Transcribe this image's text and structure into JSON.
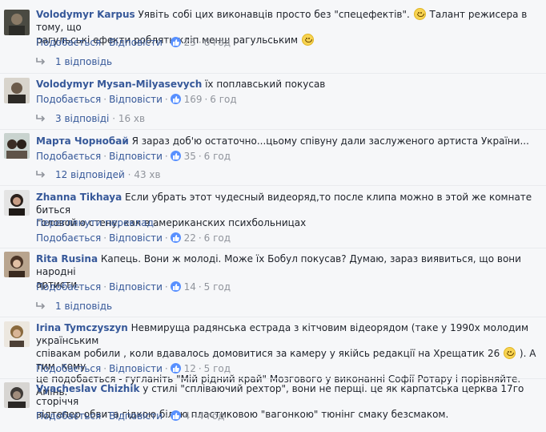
{
  "actions": {
    "like": "Подобається",
    "reply": "Відповісти",
    "dot": "·"
  },
  "comments": [
    {
      "author": "Volodymyr Karpus",
      "text_a": "Уявіть собі цих виконавців просто без \"спецефектів\".",
      "text_b": "Талант режисера в тому, що",
      "text_c": "рагульські ефекти роблять кліп менш рагульським",
      "likes": "25",
      "time": "6 год",
      "replies": "1 відповідь",
      "replies_time": ""
    },
    {
      "author": "Volodymyr Mysan-Milyasevych",
      "text_a": "їх поплавський покусав",
      "likes": "169",
      "time": "6 год",
      "replies": "3 відповіді",
      "replies_time": "16 хв"
    },
    {
      "author": "Марта Чорнобай",
      "text_a": "Я зараз доб'ю остаточно...цьому співуну дали заслуженого артиста України...",
      "likes": "35",
      "time": "6 год",
      "replies": "12 відповідей",
      "replies_time": "43 хв"
    },
    {
      "author": "Zhanna Tikhaya",
      "text_a": "Если убрать этот чудесный видеоряд,то после клипа можно в этой же комнате биться",
      "text_b": "головой о стену, как в американских психбольницах",
      "translate": "Переглянути переклад",
      "likes": "22",
      "time": "6 год"
    },
    {
      "author": "Rita Rusina",
      "text_a": "Капець. Вони ж молоді. Може їх Бобул покусав? Думаю, зараз виявиться, що вони народні",
      "text_b": "артисти.",
      "likes": "14",
      "time": "5 год",
      "replies": "1 відповідь",
      "replies_time": ""
    },
    {
      "author": "Irina Tymczyszyn",
      "text_a": "Невмируща радянська естрада з кітчовим відеорядом (таке у 1990х молодим українським",
      "text_b": "співакам робили , коли вдавалось домовитися за камеру у якійсь редакції на Хрещатик 26",
      "text_c": "). А тим, кому",
      "text_d": "це подобається - гугланіть \"Мій рідний край\" Мозгового у виконанні Софії Ротару і порівняйте. Амінь.",
      "likes": "12",
      "time": "5 год"
    },
    {
      "author": "Vyacheslav Chizhik",
      "text_a": "у стилі \"спліваючий рехтор\", вони не перщі. це як карпатська церква 17го сторіччя",
      "text_b": "відтепер обвита гідкою білою пластиковою \"вагонкою\" тюнінг смаку безсмаком.",
      "likes": "4",
      "time": "4 год"
    }
  ]
}
